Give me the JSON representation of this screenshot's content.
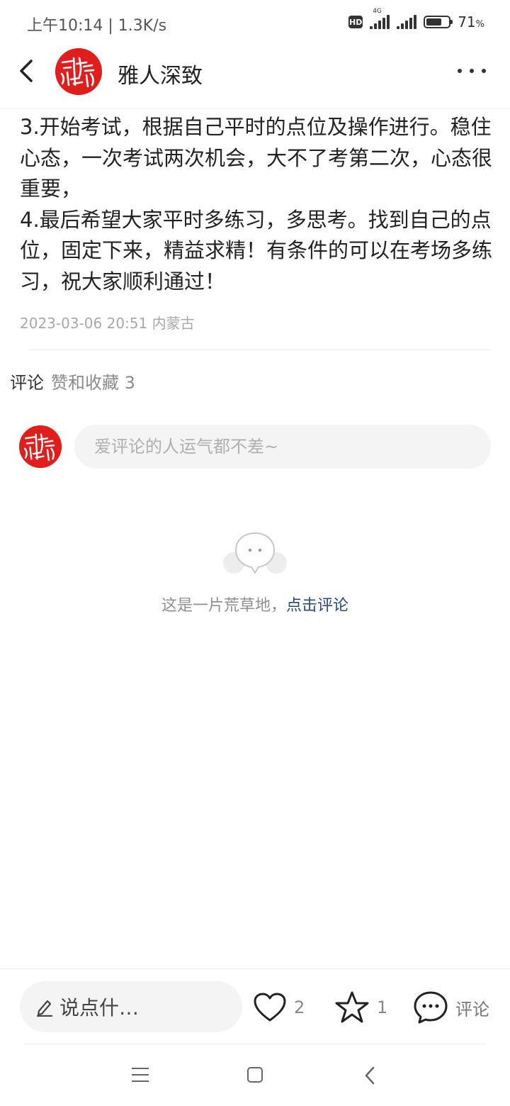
{
  "status_bar": {
    "time_speed": "上午10:14 | 1.3K/s",
    "hd": "HD",
    "network": "4G",
    "battery_percent": "71",
    "battery_unit": "%",
    "battery_level": 0.71
  },
  "header": {
    "author_name": "雅人深致",
    "avatar_color": "#e01e1e",
    "back_icon": "chevron-left-icon",
    "more_icon": "more-horizontal-icon"
  },
  "article": {
    "paragraphs": [
      "3.开始考试，根据自己平时的点位及操作进行。稳住心态，一次考试两次机会，大不了考第二次，心态很重要，",
      "4.最后希望大家平时多练习，多思考。找到自己的点位，固定下来，精益求精！有条件的可以在考场多练习，祝大家顺利通过！"
    ],
    "meta": "2023-03-06 20:51 内蒙古"
  },
  "comments": {
    "tab_label": "评论",
    "likes_tab_label": "赞和收藏 3",
    "input_placeholder": "爱评论的人运气都不差~",
    "empty_text": "这是一片荒草地，",
    "empty_link": "点击评论"
  },
  "bottom_bar": {
    "say_label": "说点什…",
    "like_count": "2",
    "fav_count": "1",
    "comment_label": "评论"
  },
  "colors": {
    "accent_link": "#2b4a73",
    "avatar_red": "#e01e1e"
  }
}
